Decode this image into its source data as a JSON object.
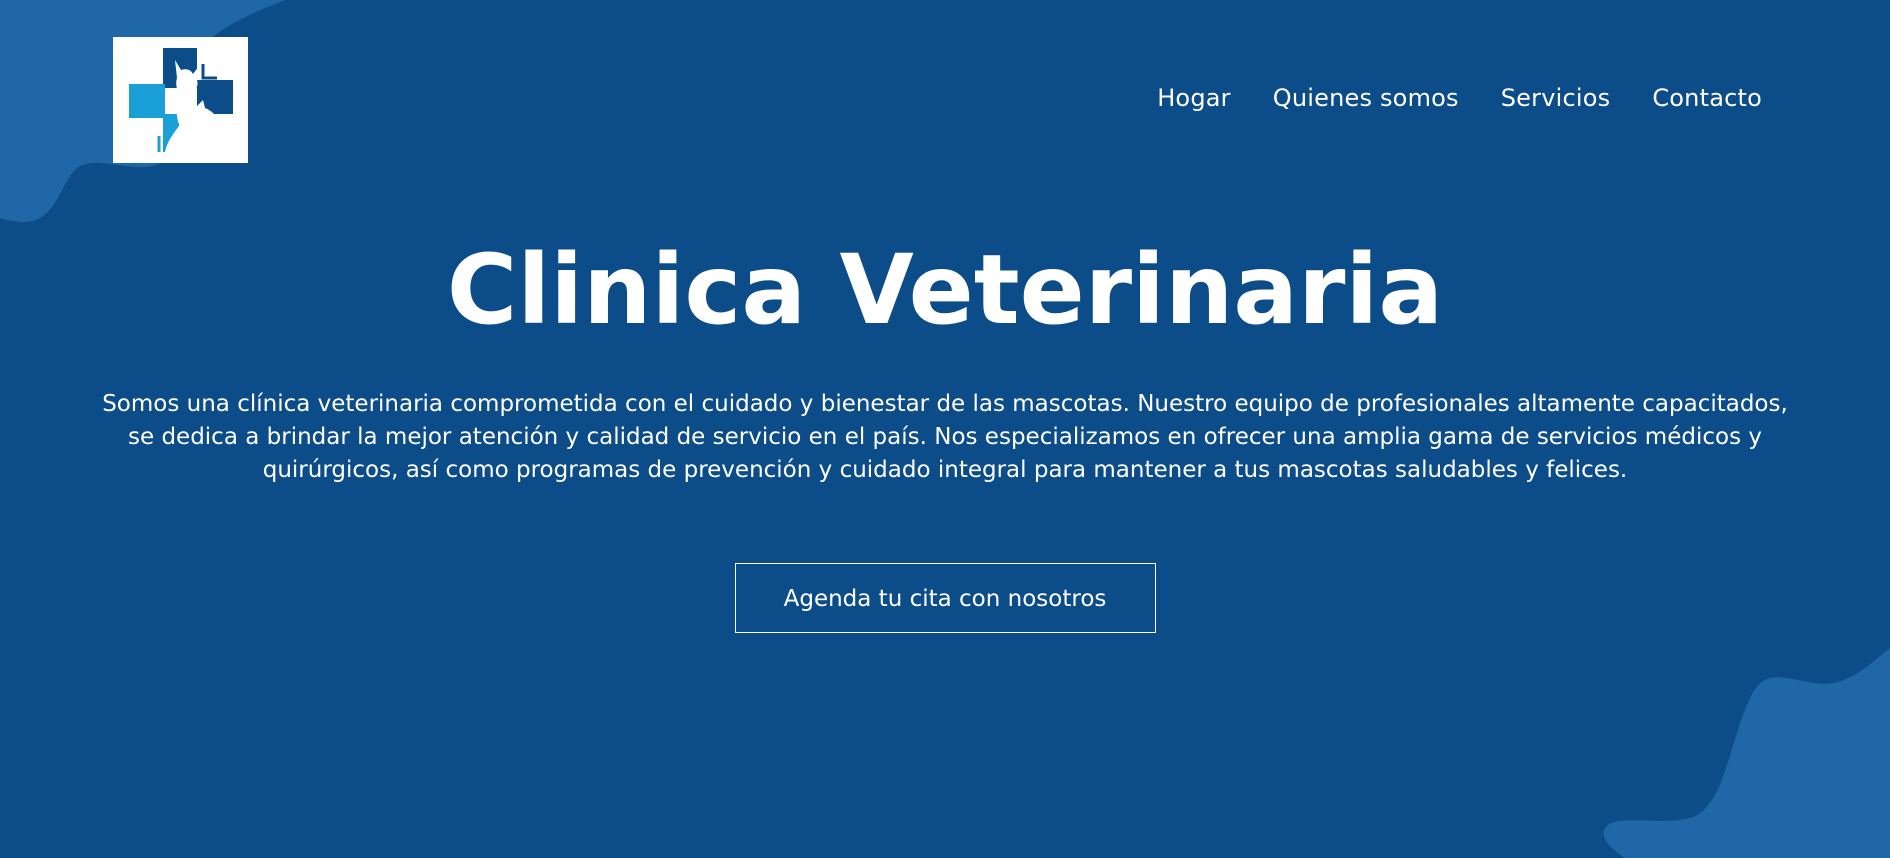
{
  "colors": {
    "background": "#0b4c89",
    "blob": "#1f67a6",
    "text": "#ffffff",
    "logo_dark": "#0b4c89",
    "logo_light": "#1aa0d6"
  },
  "logo": {
    "icon": "vet-cross-pets-logo-icon"
  },
  "nav": {
    "items": [
      {
        "label": "Hogar"
      },
      {
        "label": "Quienes somos"
      },
      {
        "label": "Servicios"
      },
      {
        "label": "Contacto"
      }
    ]
  },
  "hero": {
    "title": "Clinica Veterinaria",
    "description": "Somos una clínica veterinaria comprometida con el cuidado y bienestar de las mascotas. Nuestro equipo de profesionales altamente capacitados, se dedica a brindar la mejor atención y calidad de servicio en el país. Nos especializamos en ofrecer una amplia gama de servicios médicos y quirúrgicos, así como programas de prevención y cuidado integral para mantener a tus mascotas saludables y felices.",
    "cta_label": "Agenda tu cita con nosotros"
  }
}
